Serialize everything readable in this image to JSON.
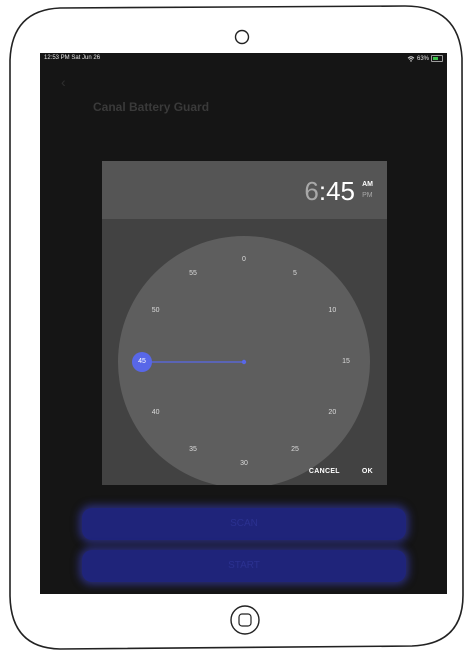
{
  "status_bar": {
    "time_date": "12:53 PM  Sat Jun 26",
    "battery": "63%"
  },
  "app": {
    "title": "Canal Battery Guard",
    "scan_label": "SCAN",
    "start_label": "START"
  },
  "time_picker": {
    "hour": "6",
    "separator": ":",
    "minute": "45",
    "am_label": "AM",
    "pm_label": "PM",
    "selected_period": "AM",
    "selected_minute": 45,
    "minute_labels": [
      "0",
      "5",
      "10",
      "15",
      "20",
      "25",
      "30",
      "35",
      "40",
      "45",
      "50",
      "55"
    ],
    "cancel_label": "CANCEL",
    "ok_label": "OK",
    "colors": {
      "accent": "#5867e8",
      "dial": "#5e5e5e",
      "header": "#555555",
      "dialog": "#424242"
    }
  },
  "icons": [
    "back-chevron-icon",
    "wifi-icon",
    "battery-icon",
    "home-button-icon",
    "front-camera-icon"
  ]
}
